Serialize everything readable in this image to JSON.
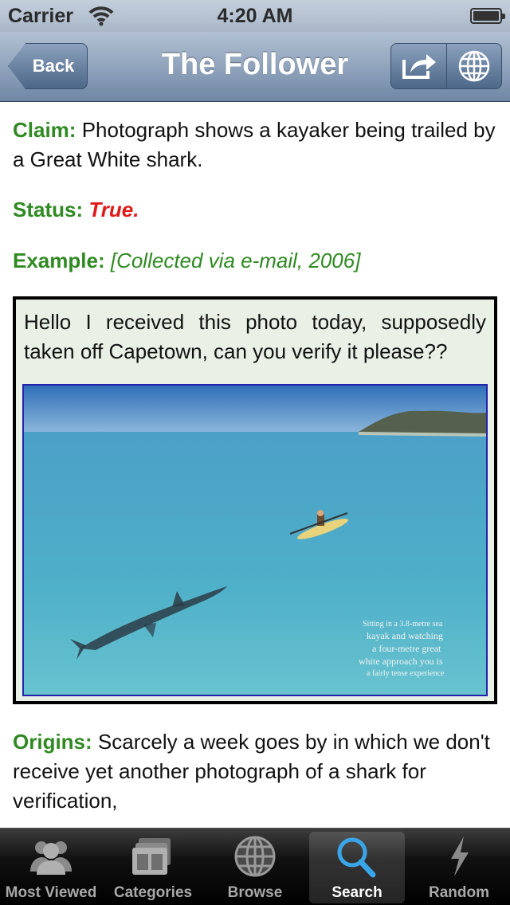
{
  "status_bar": {
    "carrier": "Carrier",
    "time": "4:20 AM"
  },
  "nav": {
    "back_label": "Back",
    "title": "The Follower",
    "icons": [
      "share-icon",
      "globe-icon"
    ]
  },
  "content": {
    "claim_label": "Claim:",
    "claim_text": "Photograph shows a kayaker being trailed by a Great White shark.",
    "status_label": "Status:",
    "status_value": "True.",
    "example_label": "Example:",
    "example_value": "[Collected via e-mail, 2006]",
    "quote_text": "Hello I received this photo today, supposedly taken off Capetown, can you verify it please??",
    "photo_caption": [
      "Sitting in a 3.8-metre sea",
      "kayak and watching",
      "a four-metre great",
      "white approach you is",
      "a fairly tense experience"
    ],
    "origins_label": "Origins:",
    "origins_text": "Scarcely a week goes by in which we don't receive yet another photograph of a shark for verification,"
  },
  "tabs": [
    {
      "label": "Most Viewed",
      "icon": "people-icon"
    },
    {
      "label": "Categories",
      "icon": "folders-icon"
    },
    {
      "label": "Browse",
      "icon": "globe-icon"
    },
    {
      "label": "Search",
      "icon": "magnifier-icon",
      "active": true
    },
    {
      "label": "Random",
      "icon": "lightning-icon"
    }
  ],
  "colors": {
    "label_green": "#2f8a22",
    "status_red": "#e01a1a",
    "nav_blue": "#6f87a6"
  }
}
